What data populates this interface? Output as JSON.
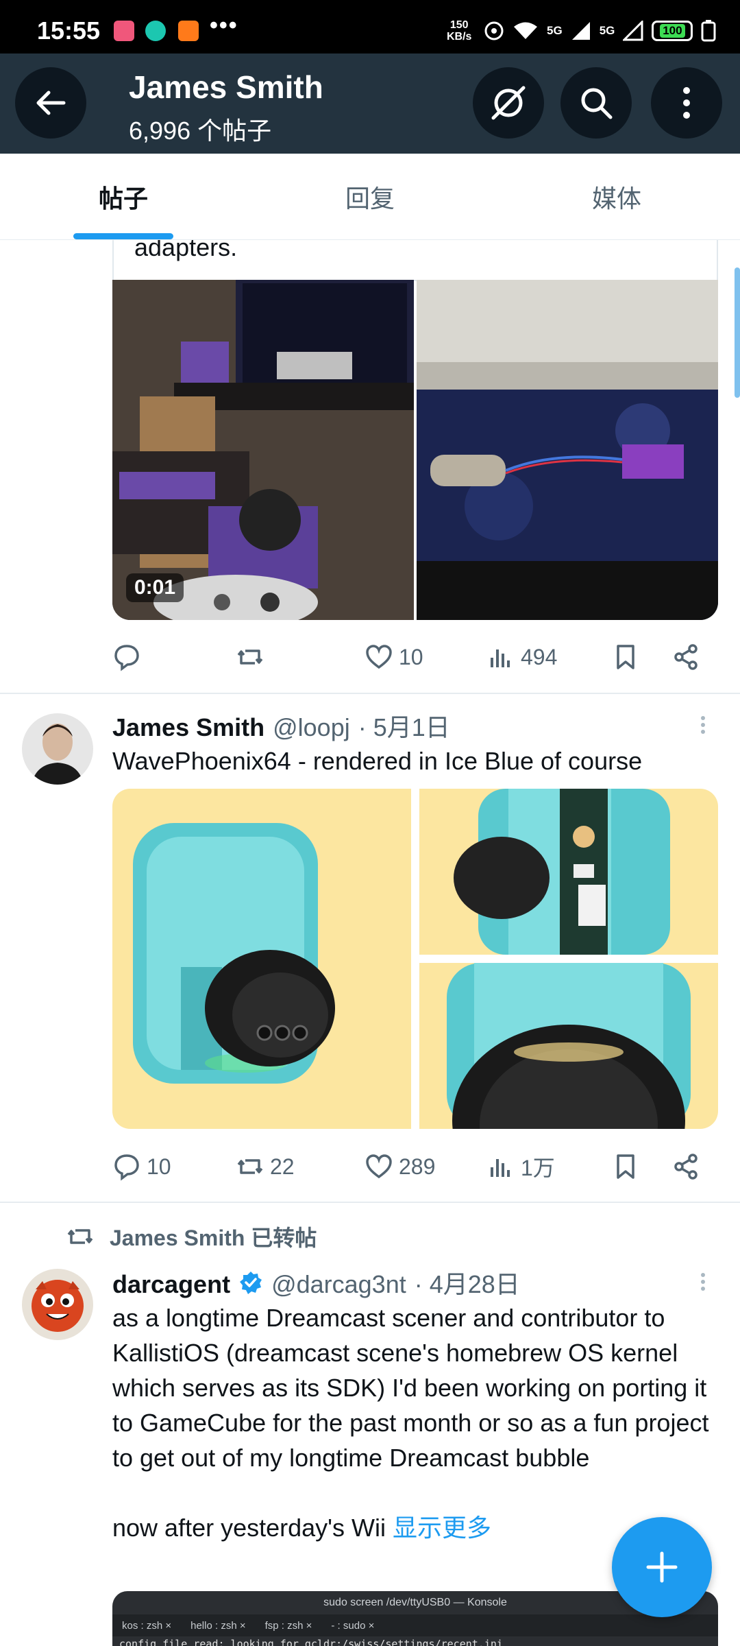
{
  "status_bar": {
    "time": "15:55",
    "dots": "•••",
    "speed_value": "150",
    "speed_unit": "KB/s",
    "net1": "5G",
    "net2": "5G",
    "battery": "100"
  },
  "header": {
    "title": "James Smith",
    "subtitle": "6,996 个帖子"
  },
  "tabs": [
    {
      "label": "帖子"
    },
    {
      "label": "回复"
    },
    {
      "label": "媒体"
    }
  ],
  "posts": [
    {
      "text_tail": "adapters.",
      "video_duration": "0:01",
      "actions": {
        "reply": "",
        "retweet": "",
        "like": "10",
        "views": "494"
      }
    },
    {
      "author": "James Smith",
      "handle": "@loopj",
      "date": "· 5月1日",
      "text": "WavePhoenix64 - rendered in Ice Blue of course",
      "actions": {
        "reply": "10",
        "retweet": "22",
        "like": "289",
        "views": "1万"
      }
    },
    {
      "retweeted_by": "James Smith 已转帖",
      "author": "darcagent",
      "handle": "@darcag3nt",
      "date": "· 4月28日",
      "text": "as a longtime Dreamcast scener and contributor to KallistiOS (dreamcast scene's homebrew OS kernel which serves as its SDK) I'd been working on porting it to GameCube for the past month or so as a fun project to get out of my longtime Dreamcast bubble\n\nnow after yesterday's Wii",
      "show_more": "显示更多",
      "terminal": {
        "title": "sudo screen /dev/ttyUSB0 — Konsole",
        "tabs": [
          "kos : zsh ×",
          "hello : zsh ×",
          "fsp : zsh ×",
          "- : sudo ×"
        ],
        "line": "config file read: looking for gcldr:/swiss/settings/recent.ini"
      }
    }
  ],
  "colors": {
    "accent": "#1d9bf0",
    "header_bg": "#23333f",
    "muted": "#536471"
  }
}
